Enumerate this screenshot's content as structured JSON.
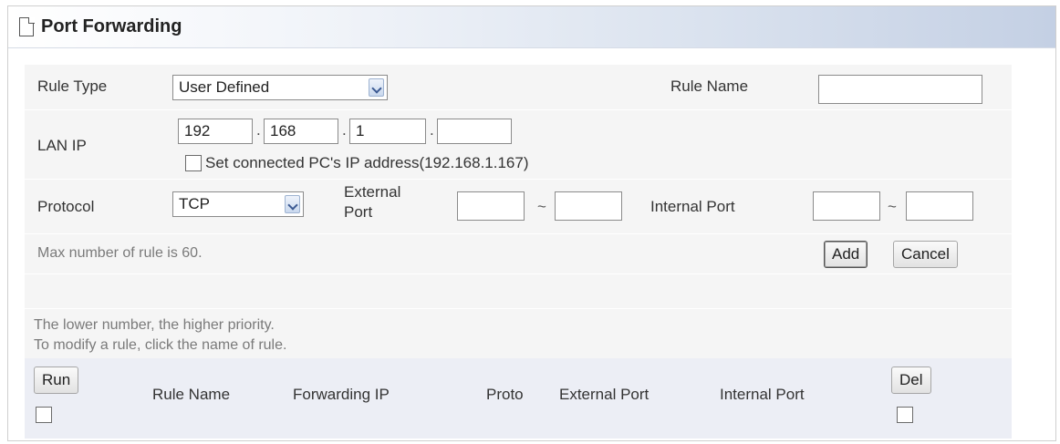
{
  "panel": {
    "title": "Port Forwarding",
    "title_icon": "document-icon"
  },
  "form": {
    "rule_type": {
      "label": "Rule Type",
      "value": "User Defined"
    },
    "rule_name": {
      "label": "Rule Name",
      "value": ""
    },
    "lan_ip": {
      "label": "LAN IP",
      "octets": [
        "192",
        "168",
        "1",
        ""
      ],
      "dot": ".",
      "checkbox_label": "Set connected PC's IP address(192.168.1.167)",
      "checked": false
    },
    "protocol": {
      "label": "Protocol",
      "value": "TCP"
    },
    "external_port": {
      "label_line1": "External",
      "label_line2": "Port",
      "from": "",
      "to": ""
    },
    "internal_port": {
      "label": "Internal Port",
      "from": "",
      "to": ""
    },
    "range_separator": "~",
    "max_rule_note": "Max number of rule is 60.",
    "add_label": "Add",
    "cancel_label": "Cancel"
  },
  "list": {
    "note_line1": "The lower number, the higher priority.",
    "note_line2": "To modify a rule, click the name of rule.",
    "run_label": "Run",
    "del_label": "Del",
    "columns": [
      "Rule Name",
      "Forwarding IP",
      "Proto",
      "External Port",
      "Internal Port"
    ]
  }
}
